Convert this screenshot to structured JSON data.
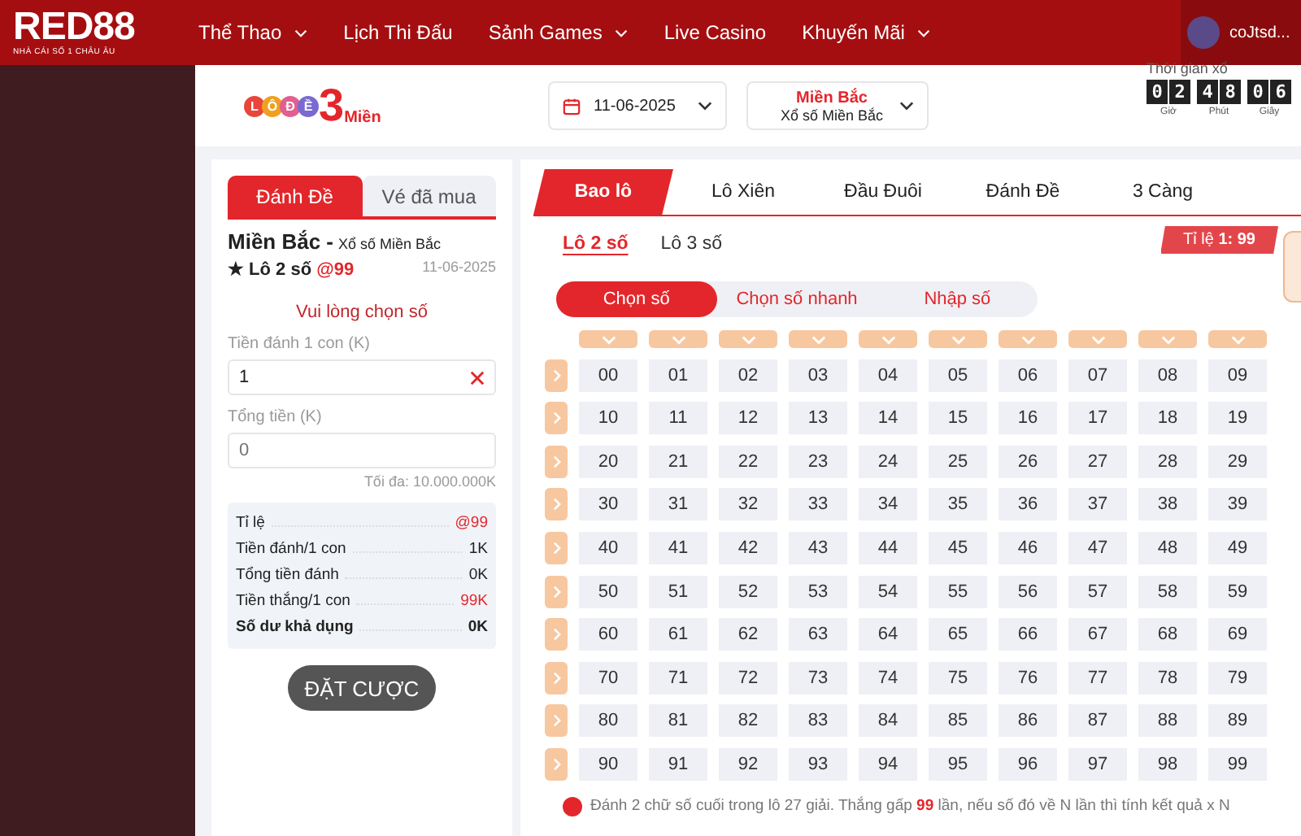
{
  "header": {
    "logo": "RED88",
    "tagline": "NHÀ CÁI SỐ 1 CHÂU ÂU",
    "nav": [
      {
        "label": "Thể Thao",
        "dropdown": true
      },
      {
        "label": "Lịch Thi Đấu",
        "dropdown": false
      },
      {
        "label": "Sảnh Games",
        "dropdown": true
      },
      {
        "label": "Live Casino",
        "dropdown": false
      },
      {
        "label": "Khuyến Mãi",
        "dropdown": true
      }
    ],
    "user": "coJtsd..."
  },
  "subheader": {
    "logo_letters": [
      "L",
      "Ô",
      "Đ",
      "Ề"
    ],
    "logo_number": "3",
    "logo_word": "Miền",
    "date": "11-06-2025",
    "region": "Miền Bắc",
    "region_sub": "Xổ số Miền Bắc",
    "timer_label": "Thời gian xổ",
    "timer": [
      {
        "digits": [
          "0",
          "2"
        ],
        "unit": "Giờ"
      },
      {
        "digits": [
          "4",
          "8"
        ],
        "unit": "Phút"
      },
      {
        "digits": [
          "0",
          "6"
        ],
        "unit": "Giây"
      }
    ]
  },
  "ticket": {
    "tabs": [
      {
        "label": "Đánh Đề",
        "selected": true
      },
      {
        "label": "Vé đã mua",
        "selected": false
      }
    ],
    "region": "Miền Bắc",
    "separator": "-",
    "region_sub": "Xổ số Miền Bắc",
    "star": "★",
    "bet_type": "Lô 2 số",
    "odds": "@99",
    "date": "11-06-2025",
    "prompt": "Vui lòng chọn số",
    "stake_label": "Tiền đánh 1 con (K)",
    "stake_value": "1",
    "total_label": "Tổng tiền (K)",
    "total_placeholder": "0",
    "max": "Tối đa: 10.000.000K",
    "summary": [
      {
        "label": "Tỉ lệ",
        "value": "@99",
        "highlight": true,
        "bold": false
      },
      {
        "label": "Tiền đánh/1 con",
        "value": "1K",
        "highlight": false,
        "bold": false
      },
      {
        "label": "Tổng tiền đánh",
        "value": "0K",
        "highlight": false,
        "bold": false
      },
      {
        "label": "Tiền thắng/1 con",
        "value": "99K",
        "highlight": true,
        "bold": false
      },
      {
        "label": "Số dư khả dụng",
        "value": "0K",
        "highlight": false,
        "bold": true
      }
    ],
    "submit": "ĐẶT CƯỢC"
  },
  "game": {
    "tabs": [
      {
        "label": "Bao lô",
        "selected": true
      },
      {
        "label": "Lô Xiên",
        "selected": false
      },
      {
        "label": "Đầu Đuôi",
        "selected": false
      },
      {
        "label": "Đánh Đề",
        "selected": false
      },
      {
        "label": "3 Càng",
        "selected": false
      }
    ],
    "subtabs": [
      {
        "label": "Lô 2 số",
        "selected": true
      },
      {
        "label": "Lô 3 số",
        "selected": false
      }
    ],
    "ratio": "Tỉ lệ **1: 99**",
    "modes": [
      {
        "label": "Chọn số",
        "selected": true
      },
      {
        "label": "Chọn số nhanh",
        "selected": false
      },
      {
        "label": "Nhập số",
        "selected": false
      }
    ],
    "rows": [
      [
        "00",
        "01",
        "02",
        "03",
        "04",
        "05",
        "06",
        "07",
        "08",
        "09"
      ],
      [
        "10",
        "11",
        "12",
        "13",
        "14",
        "15",
        "16",
        "17",
        "18",
        "19"
      ],
      [
        "20",
        "21",
        "22",
        "23",
        "24",
        "25",
        "26",
        "27",
        "28",
        "29"
      ],
      [
        "30",
        "31",
        "32",
        "33",
        "34",
        "35",
        "36",
        "37",
        "38",
        "39"
      ],
      [
        "40",
        "41",
        "42",
        "43",
        "44",
        "45",
        "46",
        "47",
        "48",
        "49"
      ],
      [
        "50",
        "51",
        "52",
        "53",
        "54",
        "55",
        "56",
        "57",
        "58",
        "59"
      ],
      [
        "60",
        "61",
        "62",
        "63",
        "64",
        "65",
        "66",
        "67",
        "68",
        "69"
      ],
      [
        "70",
        "71",
        "72",
        "73",
        "74",
        "75",
        "76",
        "77",
        "78",
        "79"
      ],
      [
        "80",
        "81",
        "82",
        "83",
        "84",
        "85",
        "86",
        "87",
        "88",
        "89"
      ],
      [
        "90",
        "91",
        "92",
        "93",
        "94",
        "95",
        "96",
        "97",
        "98",
        "99"
      ]
    ],
    "note": "Đánh 2 chữ số cuối trong lô 27 giải. Thắng gấp **99** lần, nếu số đó về N lần thì tính kết quả x N"
  }
}
